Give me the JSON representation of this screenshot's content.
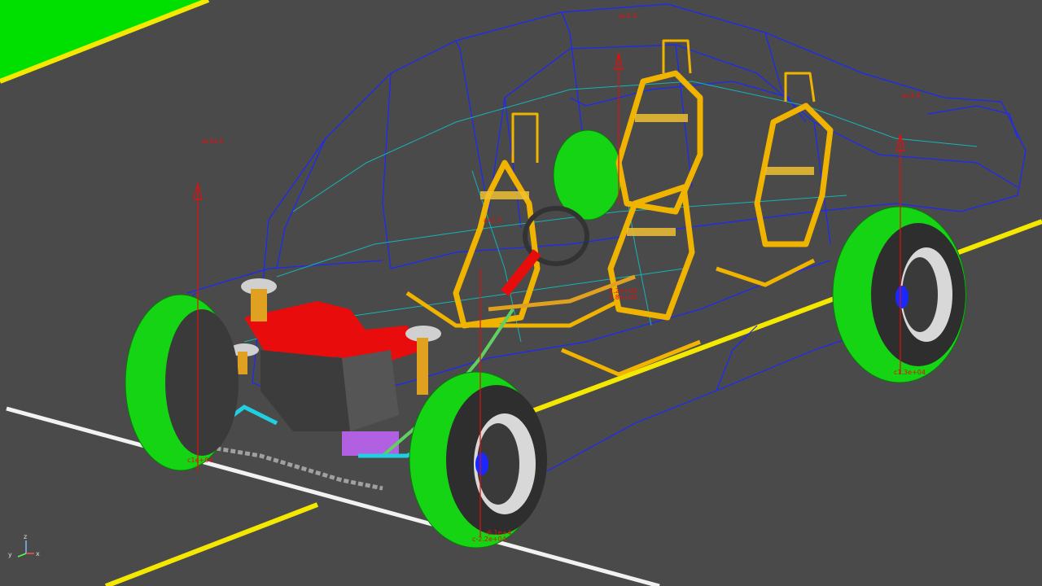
{
  "colors": {
    "background": "#4a4a4a",
    "grass": "#00e000",
    "road_yellow": "#f4e800",
    "road_white": "#f2f2f2",
    "wireframe_blue": "#1a28ff",
    "wireframe_cyan": "#15b4b4",
    "tire_green": "#14d414",
    "seat_yellow": "#f0b400",
    "engine_red": "#e80c0c",
    "engine_dark": "#3c3c3c",
    "marker_red": "#e01010",
    "triad_z": "#8ab4ff",
    "triad_x": "#ff5050",
    "triad_y": "#50ff50"
  },
  "viewport": {
    "name": "3d-model-viewport",
    "model": "vehicle-assembly-wireframe"
  },
  "markers": [
    {
      "id": "front-left-axis-label",
      "text": "ax3a.0"
    },
    {
      "id": "roof-axis-label",
      "text": "ax1.0"
    },
    {
      "id": "rear-right-axis-label",
      "text": "ax3.0"
    },
    {
      "id": "cabin-label-a",
      "text": "ax2.0"
    },
    {
      "id": "cabin-label-b",
      "text": "2.2e+04"
    },
    {
      "id": "cabin-label-c",
      "text": "2.8e+04"
    },
    {
      "id": "front-left-wheel-label",
      "text": "c1e+04"
    },
    {
      "id": "front-right-wheel-label-a",
      "text": "-6.1e+4"
    },
    {
      "id": "front-right-wheel-label-b",
      "text": "c-2.2e+04"
    },
    {
      "id": "rear-right-wheel-label",
      "text": "c1.3e+04"
    }
  ],
  "triad": {
    "z": "z",
    "y": "y",
    "x": "x"
  }
}
